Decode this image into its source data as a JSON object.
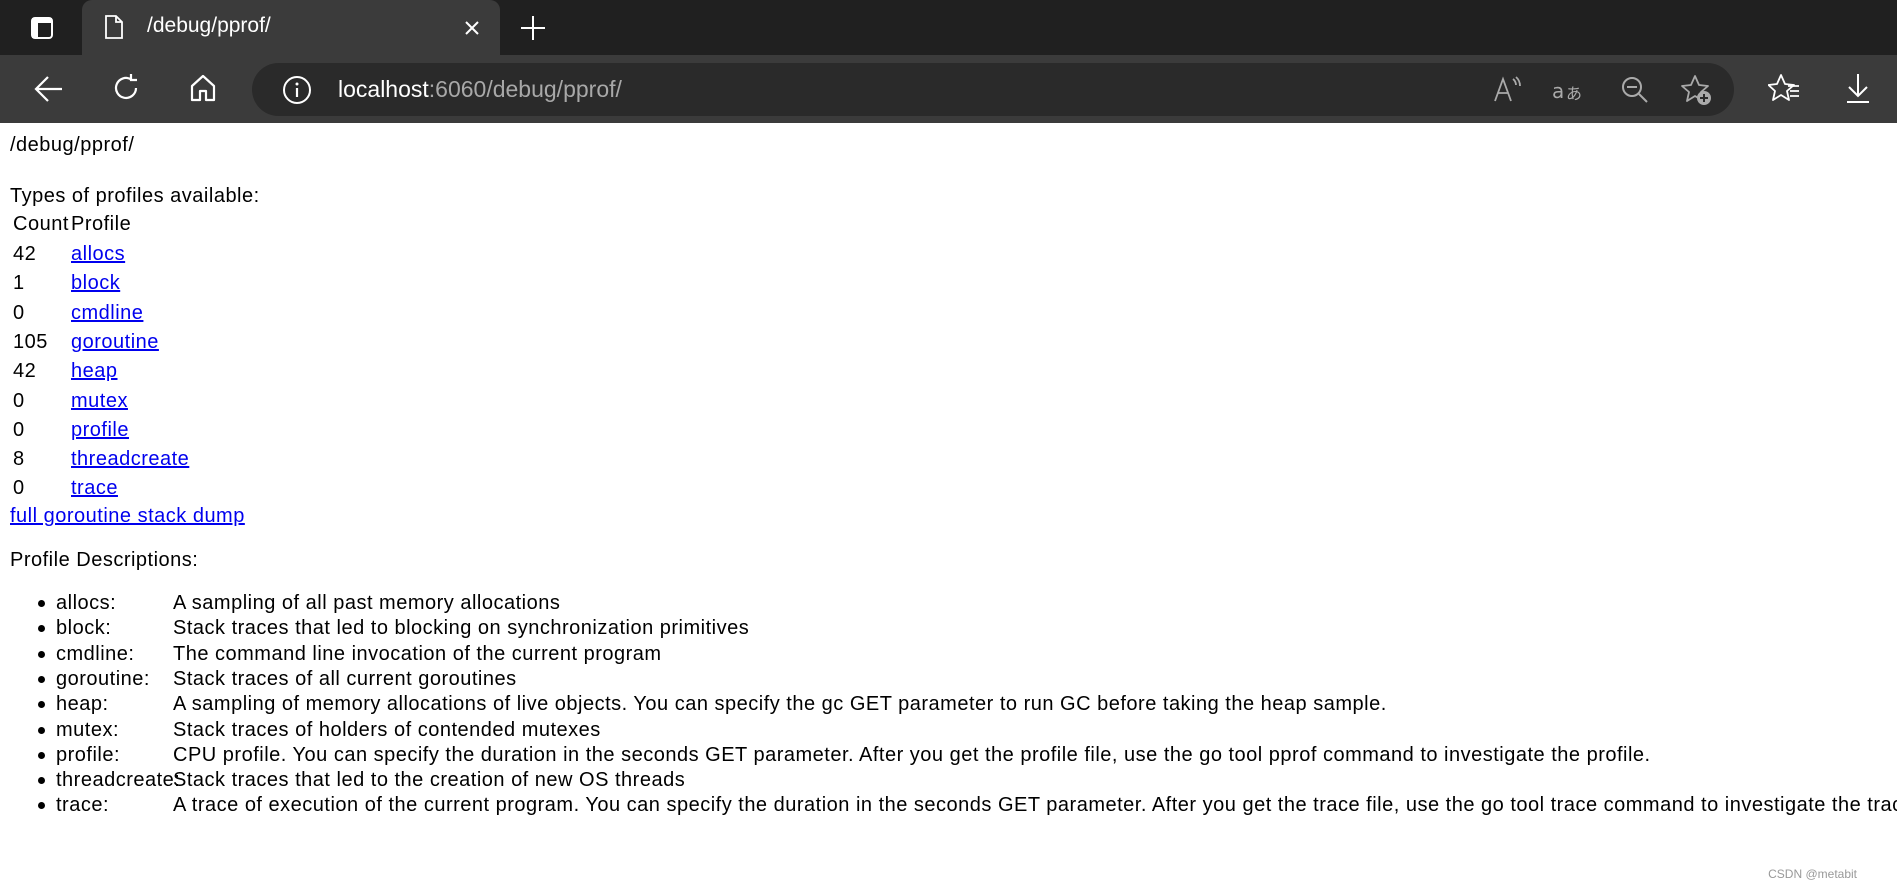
{
  "browser": {
    "tab_title": "/debug/pprof/",
    "url_host": "localhost",
    "url_rest": ":6060/debug/pprof/",
    "icons": [
      "sidebar-icon",
      "page-icon",
      "close-icon",
      "new-tab-icon",
      "back-icon",
      "refresh-icon",
      "home-icon",
      "info-icon",
      "read-aloud-icon",
      "translate-icon",
      "zoom-out-icon",
      "add-favorite-icon",
      "favorites-icon",
      "downloads-icon"
    ]
  },
  "page": {
    "heading": "/debug/pprof/",
    "types_label": "Types of profiles available:",
    "table": {
      "headers": [
        "Count",
        "Profile"
      ],
      "rows": [
        {
          "count": "42",
          "profile": "allocs"
        },
        {
          "count": "1",
          "profile": "block"
        },
        {
          "count": "0",
          "profile": "cmdline"
        },
        {
          "count": "105",
          "profile": "goroutine"
        },
        {
          "count": "42",
          "profile": "heap"
        },
        {
          "count": "0",
          "profile": "mutex"
        },
        {
          "count": "0",
          "profile": "profile"
        },
        {
          "count": "8",
          "profile": "threadcreate"
        },
        {
          "count": "0",
          "profile": "trace"
        }
      ]
    },
    "full_dump_link": "full goroutine stack dump",
    "descriptions_label": "Profile Descriptions:",
    "descriptions": [
      {
        "name": "allocs:",
        "text": "A sampling of all past memory allocations"
      },
      {
        "name": "block:",
        "text": "Stack traces that led to blocking on synchronization primitives"
      },
      {
        "name": "cmdline:",
        "text": "The command line invocation of the current program"
      },
      {
        "name": "goroutine:",
        "text": "Stack traces of all current goroutines"
      },
      {
        "name": "heap:",
        "text": "A sampling of memory allocations of live objects. You can specify the gc GET parameter to run GC before taking the heap sample."
      },
      {
        "name": "mutex:",
        "text": "Stack traces of holders of contended mutexes"
      },
      {
        "name": "profile:",
        "text": "CPU profile. You can specify the duration in the seconds GET parameter. After you get the profile file, use the go tool pprof command to investigate the profile."
      },
      {
        "name": "threadcreate:",
        "text": "Stack traces that led to the creation of new OS threads"
      },
      {
        "name": "trace:",
        "text": "A trace of execution of the current program. You can specify the duration in the seconds GET parameter. After you get the trace file, use the go tool trace command to investigate the trace."
      }
    ],
    "watermark": "CSDN @metabit"
  }
}
